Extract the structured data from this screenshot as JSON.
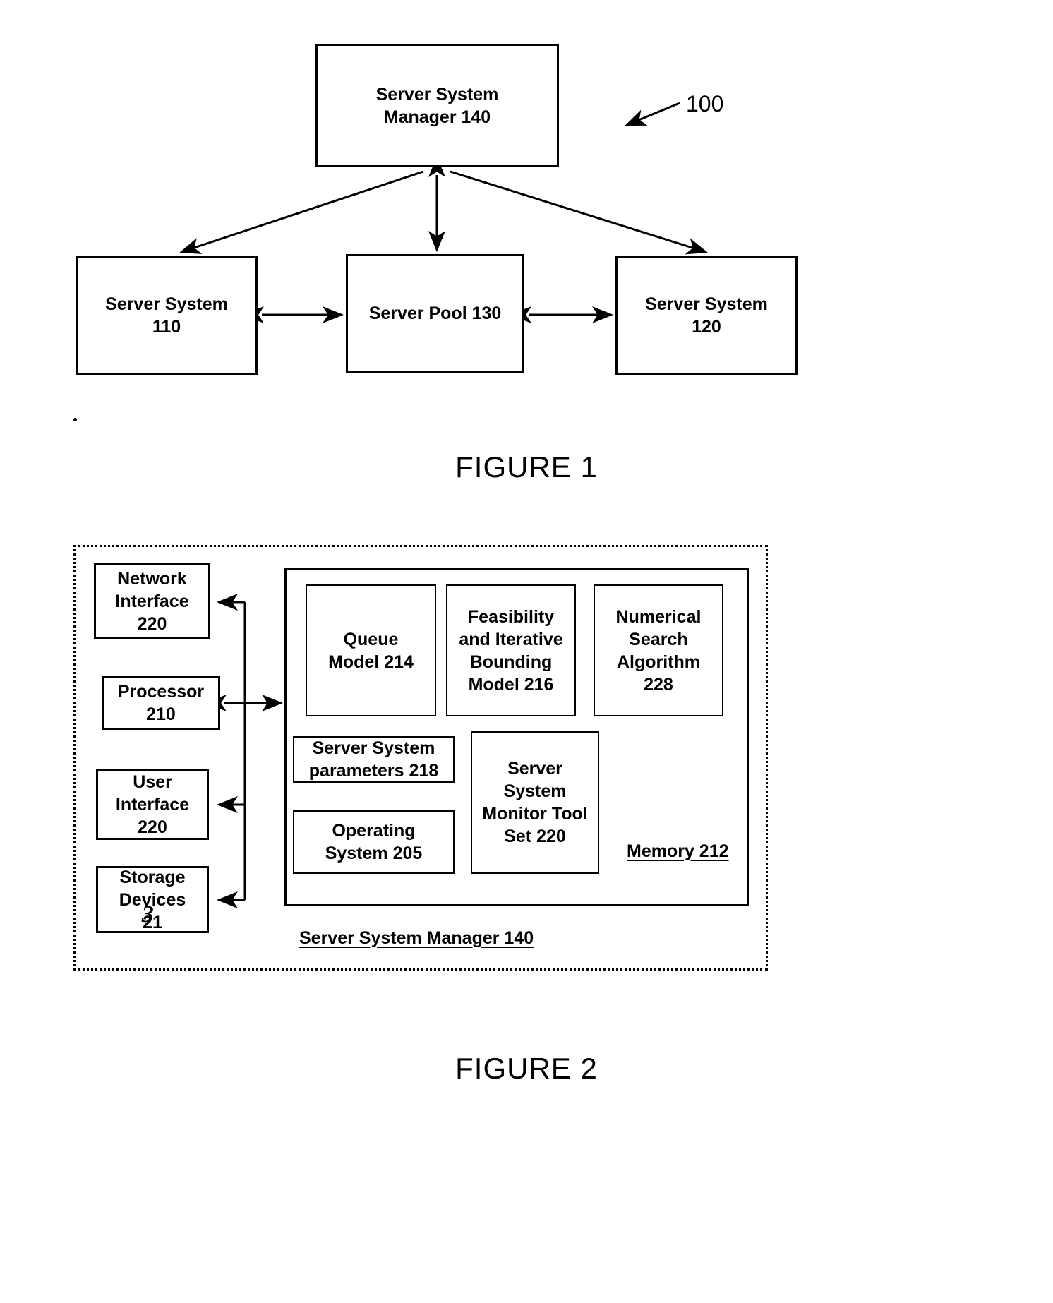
{
  "figure1": {
    "caption": "FIGURE 1",
    "reference_number": "100",
    "boxes": {
      "manager": "Server System\nManager 140",
      "server_system_110": "Server System\n110",
      "server_pool_130": "Server Pool 130",
      "server_system_120": "Server System\n120"
    },
    "connections": [
      {
        "from": "manager",
        "to": "server_system_110",
        "type": "single-arrow"
      },
      {
        "from": "manager",
        "to": "server_pool_130",
        "type": "double-arrow"
      },
      {
        "from": "manager",
        "to": "server_system_120",
        "type": "single-arrow"
      },
      {
        "from": "server_system_110",
        "to": "server_pool_130",
        "type": "double-arrow"
      },
      {
        "from": "server_pool_130",
        "to": "server_system_120",
        "type": "double-arrow"
      }
    ]
  },
  "figure2": {
    "caption": "FIGURE 2",
    "container_label": "Server System Manager 140",
    "memory_label": "Memory 212",
    "left_column": [
      {
        "name": "network-interface",
        "label": "Network\nInterface\n220"
      },
      {
        "name": "processor",
        "label": "Processor\n210"
      },
      {
        "name": "user-interface",
        "label": "User\nInterface\n220"
      },
      {
        "name": "storage-devices",
        "label": "Storage\nDevices\n21",
        "handwritten_overlay": "3",
        "printed_full": "213"
      }
    ],
    "memory_blocks": [
      {
        "name": "queue-model",
        "label": "Queue\nModel 214"
      },
      {
        "name": "feasibility-model",
        "label": "Feasibility\nand Iterative\nBounding\nModel 216"
      },
      {
        "name": "numerical-search",
        "label": "Numerical\nSearch\nAlgorithm\n228"
      },
      {
        "name": "server-system-parameters",
        "label": "Server System\nparameters 218"
      },
      {
        "name": "server-system-monitor-tool-set",
        "label": "Server\nSystem\nMonitor Tool\nSet 220"
      },
      {
        "name": "operating-system",
        "label": "Operating\nSystem 205"
      }
    ]
  },
  "colors": {
    "ink": "#000000",
    "paper": "#ffffff"
  }
}
